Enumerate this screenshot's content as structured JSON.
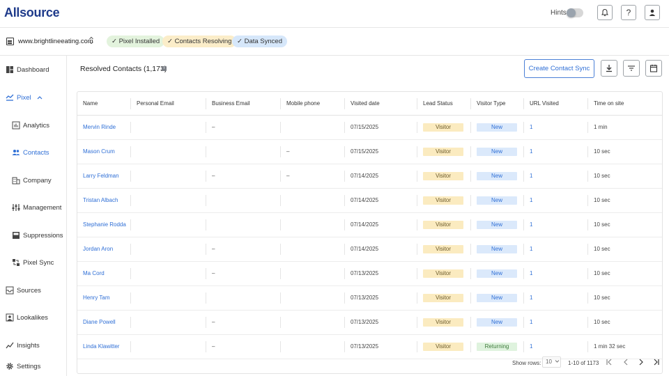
{
  "app": {
    "logo": "Allsource"
  },
  "topbar": {
    "hints_label": "Hints"
  },
  "subbar": {
    "site": "www.brightlineeating.com",
    "selector_glyph": "⌃⌄",
    "pills": [
      {
        "label": "✓ Pixel Installed",
        "color": "#e3f3dd"
      },
      {
        "label": "✓ Contacts Resolving",
        "color": "#fbedc9"
      },
      {
        "label": "✓ Data Synced",
        "color": "#d6e7fa"
      }
    ]
  },
  "sidebar": {
    "items": [
      {
        "label": "Dashboard"
      },
      {
        "label": "Pixel"
      },
      {
        "label": "Analytics"
      },
      {
        "label": "Contacts"
      },
      {
        "label": "Company"
      },
      {
        "label": "Management"
      },
      {
        "label": "Suppressions"
      },
      {
        "label": "Pixel Sync"
      },
      {
        "label": "Sources"
      },
      {
        "label": "Lookalikes"
      },
      {
        "label": "Insights"
      },
      {
        "label": "Settings"
      }
    ]
  },
  "main": {
    "title": "Resolved Contacts (1,173)",
    "info_glyph": "i",
    "create_button": "Create Contact Sync"
  },
  "table": {
    "columns": [
      "Name",
      "Personal Email",
      "Business Email",
      "Mobile phone",
      "Visited date",
      "Lead Status",
      "Visitor Type",
      "URL Visited",
      "Time on site"
    ],
    "rows": [
      {
        "name": "Mervin Rinde",
        "personal": "",
        "business": "–",
        "mobile": "",
        "date": "07/15/2025",
        "lead": "Visitor",
        "type": "New",
        "url": "1",
        "time": "1 min"
      },
      {
        "name": "Mason Crum",
        "personal": "",
        "business": "",
        "mobile": "–",
        "date": "07/15/2025",
        "lead": "Visitor",
        "type": "New",
        "url": "1",
        "time": "10 sec"
      },
      {
        "name": "Larry Feldman",
        "personal": "",
        "business": "–",
        "mobile": "–",
        "date": "07/14/2025",
        "lead": "Visitor",
        "type": "New",
        "url": "1",
        "time": "10 sec"
      },
      {
        "name": "Tristan Albach",
        "personal": "",
        "business": "",
        "mobile": "",
        "date": "07/14/2025",
        "lead": "Visitor",
        "type": "New",
        "url": "1",
        "time": "10 sec"
      },
      {
        "name": "Stephanie Rodda",
        "personal": "",
        "business": "",
        "mobile": "",
        "date": "07/14/2025",
        "lead": "Visitor",
        "type": "New",
        "url": "1",
        "time": "10 sec"
      },
      {
        "name": "Jordan Aron",
        "personal": "",
        "business": "–",
        "mobile": "",
        "date": "07/14/2025",
        "lead": "Visitor",
        "type": "New",
        "url": "1",
        "time": "10 sec"
      },
      {
        "name": "Ma Cord",
        "personal": "",
        "business": "–",
        "mobile": "",
        "date": "07/13/2025",
        "lead": "Visitor",
        "type": "New",
        "url": "1",
        "time": "10 sec"
      },
      {
        "name": "Henry Tam",
        "personal": "",
        "business": "",
        "mobile": "",
        "date": "07/13/2025",
        "lead": "Visitor",
        "type": "New",
        "url": "1",
        "time": "10 sec"
      },
      {
        "name": "Diane Powell",
        "personal": "",
        "business": "–",
        "mobile": "",
        "date": "07/13/2025",
        "lead": "Visitor",
        "type": "New",
        "url": "1",
        "time": "10 sec"
      },
      {
        "name": "Linda Klawitter",
        "personal": "",
        "business": "–",
        "mobile": "",
        "date": "07/13/2025",
        "lead": "Visitor",
        "type": "Returning",
        "url": "1",
        "time": "1 min 32 sec"
      }
    ]
  },
  "footer": {
    "rows_label": "Show rows:",
    "rows_value": "10",
    "range": "1-10 of 1173"
  },
  "colors": {
    "accent": "#2f6fd6",
    "brand": "#1e3a8a"
  }
}
